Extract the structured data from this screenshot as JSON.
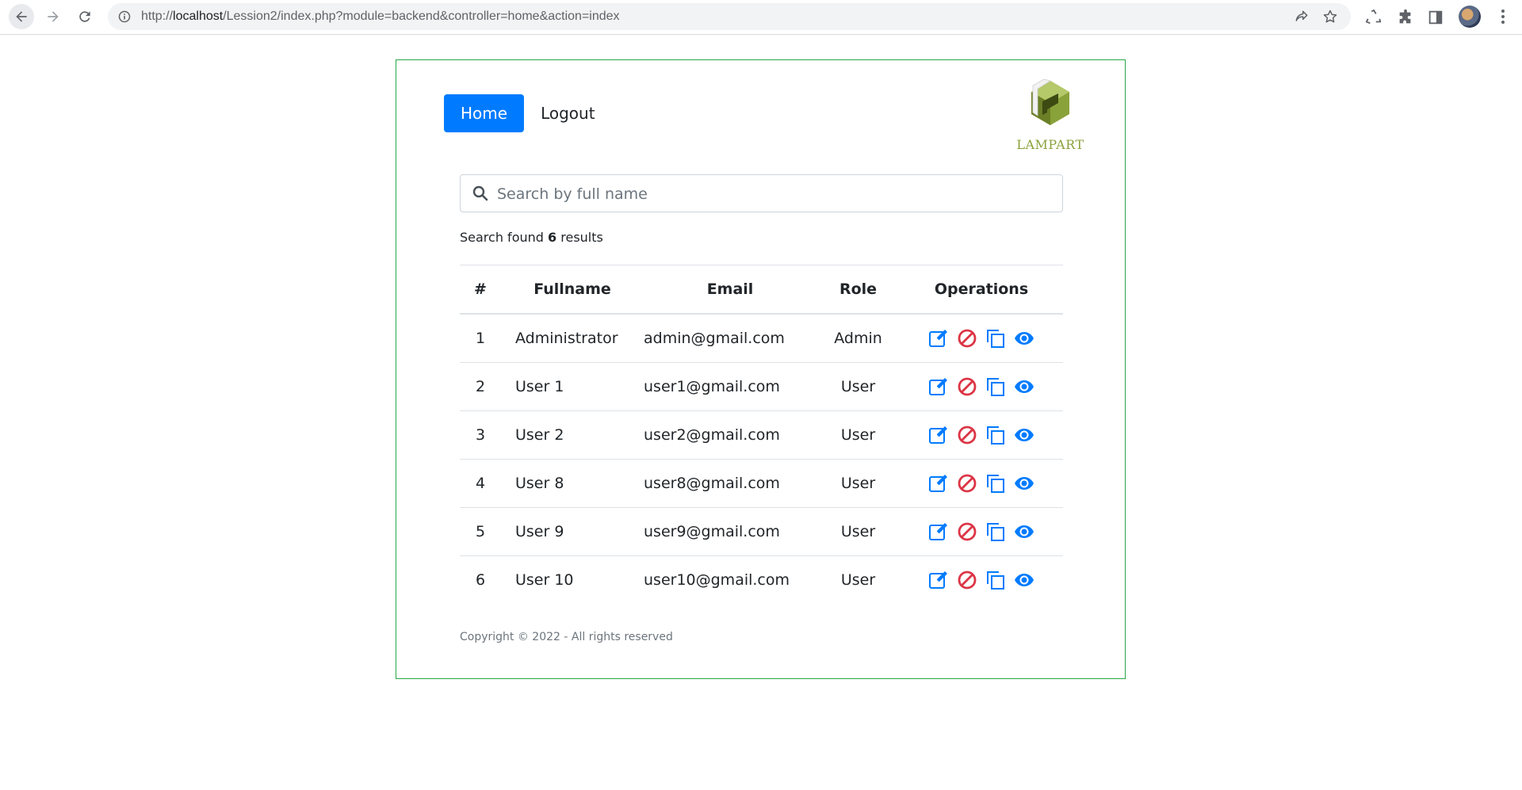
{
  "browser": {
    "url_prefix": "http://",
    "url_host": "localhost",
    "url_path": "/Lession2/index.php?module=backend&controller=home&action=index"
  },
  "nav": {
    "home_label": "Home",
    "logout_label": "Logout"
  },
  "logo": {
    "text": "LAMPART"
  },
  "search": {
    "placeholder": "Search by full name",
    "value": ""
  },
  "results": {
    "prefix": "Search found",
    "count": "6",
    "suffix": "results"
  },
  "table": {
    "headers": [
      "#",
      "Fullname",
      "Email",
      "Role",
      "Operations"
    ],
    "rows": [
      {
        "id": "1",
        "fullname": "Administrator",
        "email": "admin@gmail.com",
        "role": "Admin"
      },
      {
        "id": "2",
        "fullname": "User 1",
        "email": "user1@gmail.com",
        "role": "User"
      },
      {
        "id": "3",
        "fullname": "User 2",
        "email": "user2@gmail.com",
        "role": "User"
      },
      {
        "id": "4",
        "fullname": "User 8",
        "email": "user8@gmail.com",
        "role": "User"
      },
      {
        "id": "5",
        "fullname": "User 9",
        "email": "user9@gmail.com",
        "role": "User"
      },
      {
        "id": "6",
        "fullname": "User 10",
        "email": "user10@gmail.com",
        "role": "User"
      }
    ],
    "operations": [
      "edit-icon",
      "block-icon",
      "copy-icon",
      "view-icon"
    ]
  },
  "footer": {
    "copyright": "Copyright © 2022 - All rights reserved"
  },
  "colors": {
    "primary": "#007bff",
    "danger": "#dc3545",
    "border_success": "#28a745",
    "logo_green": "#8aa23a"
  }
}
